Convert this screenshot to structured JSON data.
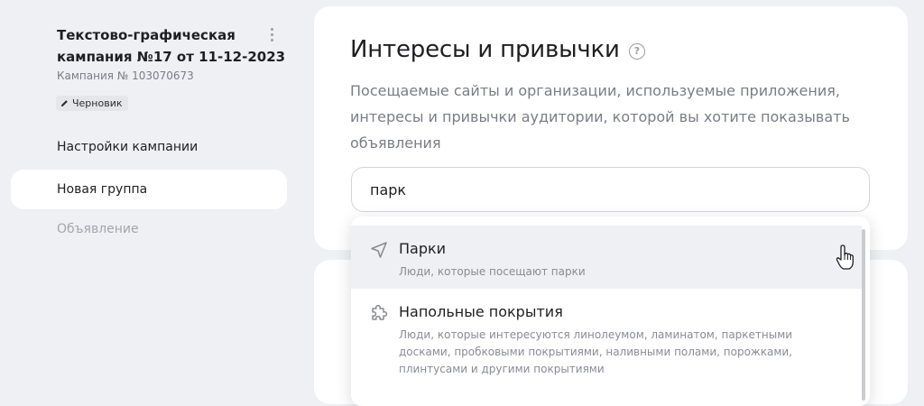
{
  "sidebar": {
    "campaign": {
      "title_line1": "Текстово-графическая",
      "title_line2": "кампания №17 от 11-12-2023",
      "number": "Кампания № 103070673",
      "status": "Черновик"
    },
    "nav": {
      "settings": "Настройки кампании",
      "new_group": "Новая группа",
      "ad": "Объявление"
    }
  },
  "main": {
    "title": "Интересы и привычки",
    "help_glyph": "?",
    "description": "Посещаемые сайты и организации, используемые приложения, интересы и привычки аудитории, которой вы хотите показывать объявления",
    "search_value": "парк"
  },
  "dropdown": {
    "options": [
      {
        "title": "Парки",
        "description": "Люди, которые посещают парки",
        "icon": "location-arrow-icon"
      },
      {
        "title": "Напольные покрытия",
        "description": "Люди, которые интересуются линолеумом, ламинатом, паркетными досками, пробковыми покрытиями, наливными полами, порожками, плинтусами и другими покрытиями",
        "icon": "puzzle-icon"
      }
    ]
  },
  "colors": {
    "background": "#eef0f4",
    "card": "#ffffff",
    "text": "#1f1f21",
    "muted": "#7b7d85",
    "hover": "#eef0f3"
  }
}
